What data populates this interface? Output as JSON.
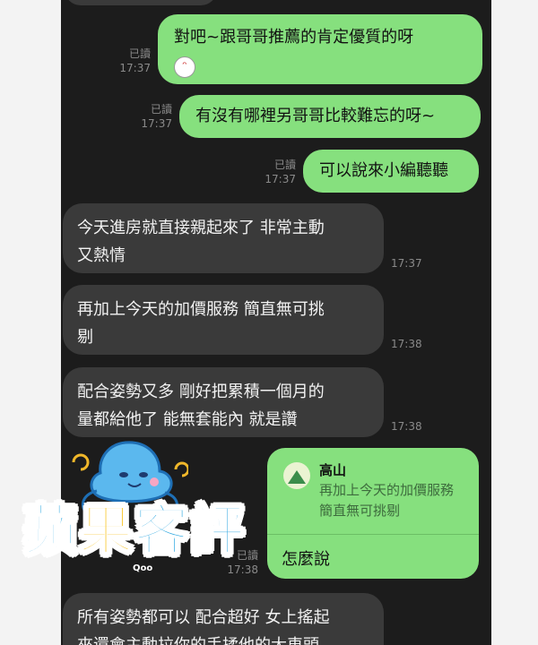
{
  "messages": {
    "out1": {
      "text": "對吧~跟哥哥推薦的肯定優質的呀",
      "read": "已讀",
      "time": "17:37"
    },
    "out2": {
      "text": "有沒有哪裡另哥哥比較難忘的呀~",
      "read": "已讀",
      "time": "17:37"
    },
    "out3": {
      "text": "可以說來小編聽聽",
      "read": "已讀",
      "time": "17:37"
    },
    "in1": {
      "line1": "今天進房就直接親起來了 非常主動",
      "line2": "又熱情",
      "time": "17:37"
    },
    "in2": {
      "line1": "再加上今天的加價服務 簡直無可挑",
      "line2": "剔",
      "time": "17:38"
    },
    "in3": {
      "line1": "配合姿勢又多 剛好把累積一個月的",
      "line2": "量都給他了 能無套能內 就是讚",
      "time": "17:38"
    },
    "reply": {
      "quoted_name": "高山",
      "quoted_line1": "再加上今天的加價服務",
      "quoted_line2": "簡直無可挑剔",
      "text": "怎麼說",
      "read": "已讀",
      "time": "17:38"
    },
    "in4": {
      "line1": "所有姿勢都可以 配合超好 女上搖起",
      "line2": "來還會主動拉你的手揉他的大車頭"
    }
  },
  "logo": {
    "text": "蘋果客評",
    "brand": "Qoo"
  },
  "colors": {
    "outgoing": "#86e07e",
    "incoming": "#3a3a3a",
    "background": "#1c1c1c"
  }
}
